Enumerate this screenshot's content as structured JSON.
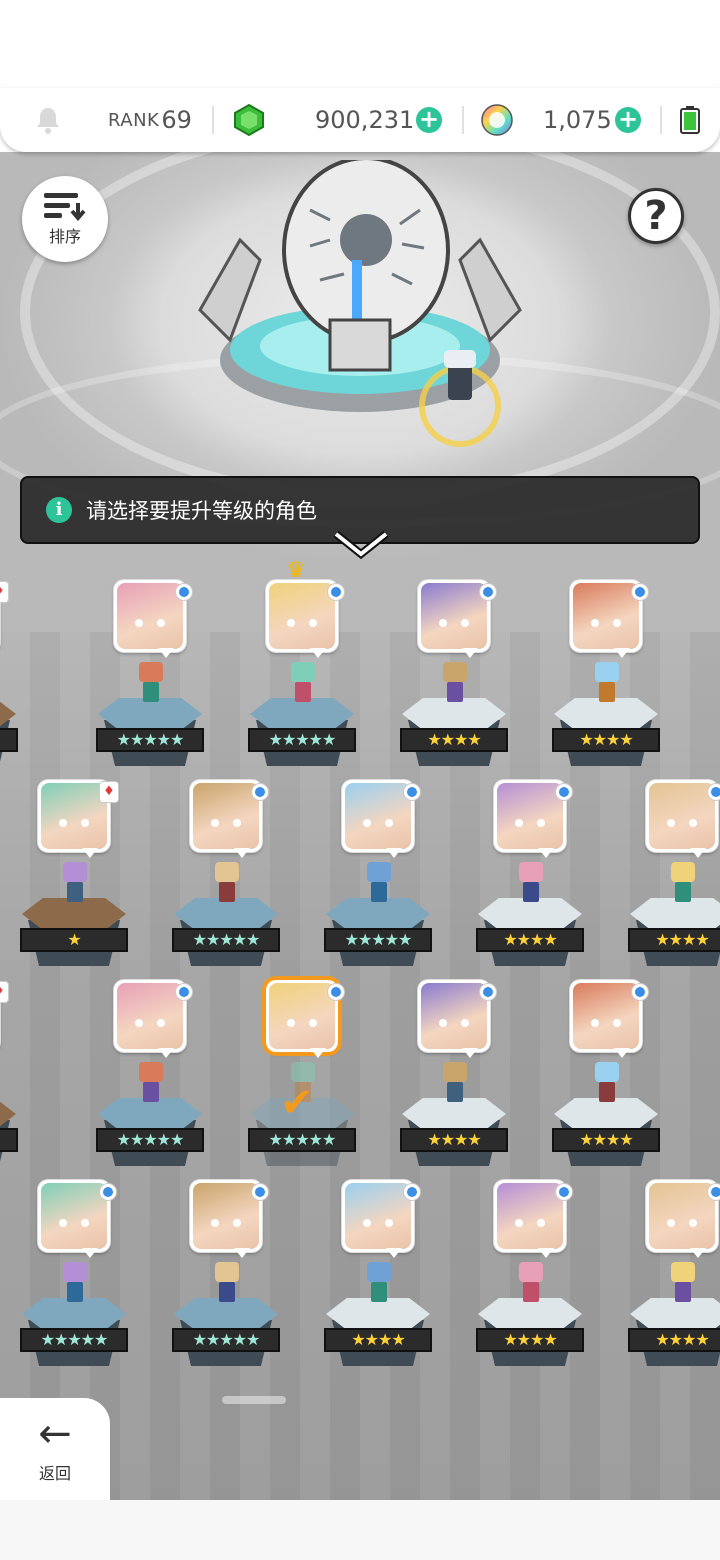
{
  "topbar": {
    "rank_label": "RANK",
    "rank_value": "69",
    "gold_amount": "900,231",
    "orb_amount": "1,075",
    "icons": [
      "bell-icon",
      "green-gem-icon",
      "plus-icon",
      "rainbow-orb-icon",
      "plus-icon",
      "battery-icon"
    ]
  },
  "buttons": {
    "sort_label": "排序",
    "help_glyph": "?",
    "back_label": "返回"
  },
  "hint": {
    "text": "请选择要提升等级的角色"
  },
  "colors": {
    "accent_green": "#2ec49a",
    "selection_orange": "#f39a1e",
    "element_dot_blue": "#3a8ee6",
    "star_gold": "#ffd23a"
  },
  "heroes": [
    {
      "row": 1,
      "col": 0,
      "stars": "★",
      "badge": "card"
    },
    {
      "row": 1,
      "col": 1,
      "stars": "★★★★★",
      "badge": "dot"
    },
    {
      "row": 1,
      "col": 2,
      "stars": "★★★★★",
      "badge": "dot",
      "leader": true
    },
    {
      "row": 1,
      "col": 3,
      "stars": "★★★★",
      "badge": "dot"
    },
    {
      "row": 1,
      "col": 4,
      "stars": "★★★★",
      "badge": "dot"
    },
    {
      "row": 2,
      "col": 0,
      "stars": "★",
      "badge": "card"
    },
    {
      "row": 2,
      "col": 1,
      "stars": "★★★★★",
      "badge": "dot"
    },
    {
      "row": 2,
      "col": 2,
      "stars": "★★★★★",
      "badge": "dot"
    },
    {
      "row": 2,
      "col": 3,
      "stars": "★★★★",
      "badge": "dot"
    },
    {
      "row": 2,
      "col": 4,
      "stars": "★★★★",
      "badge": "dot"
    },
    {
      "row": 3,
      "col": 0,
      "stars": "★",
      "badge": "card"
    },
    {
      "row": 3,
      "col": 1,
      "stars": "★★★★★",
      "badge": "dot"
    },
    {
      "row": 3,
      "col": 2,
      "stars": "★★★★★",
      "badge": "dot",
      "selected": true
    },
    {
      "row": 3,
      "col": 3,
      "stars": "★★★★",
      "badge": "dot"
    },
    {
      "row": 3,
      "col": 4,
      "stars": "★★★★",
      "badge": "dot"
    },
    {
      "row": 4,
      "col": 0,
      "stars": "★★★★★",
      "badge": "dot"
    },
    {
      "row": 4,
      "col": 1,
      "stars": "★★★★★",
      "badge": "dot"
    },
    {
      "row": 4,
      "col": 2,
      "stars": "★★★★",
      "badge": "dot"
    },
    {
      "row": 4,
      "col": 3,
      "stars": "★★★★",
      "badge": "dot"
    },
    {
      "row": 4,
      "col": 4,
      "stars": "★★★★",
      "badge": "dot"
    }
  ]
}
